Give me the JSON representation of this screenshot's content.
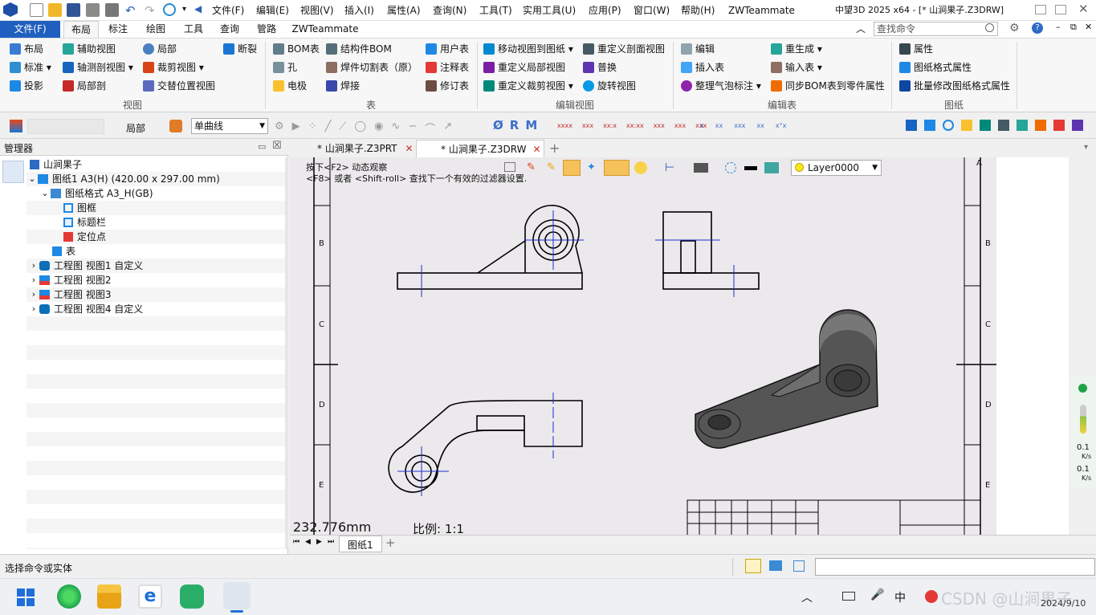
{
  "titlebar": {
    "window_title": "中望3D 2025 x64 - [* 山涧果子.Z3DRW]",
    "menus": [
      "文件(F)",
      "编辑(E)",
      "视图(V)",
      "插入(I)",
      "属性(A)",
      "查询(N)",
      "工具(T)",
      "实用工具(U)",
      "应用(P)",
      "窗口(W)",
      "帮助(H)",
      "ZWTeammate"
    ]
  },
  "ribbon_tabs": [
    "文件(F)",
    "布局",
    "标注",
    "绘图",
    "工具",
    "查询",
    "管路",
    "ZWTeammate"
  ],
  "active_tab": "布局",
  "search": {
    "placeholder": "查找命令"
  },
  "ribbon": {
    "view": {
      "label": "视图",
      "col1": [
        "布局",
        "标准 ▾",
        "投影"
      ],
      "col2": [
        "辅助视图",
        "轴测剖视图 ▾",
        "局部剖"
      ],
      "col3": [
        "局部",
        "裁剪视图 ▾",
        "交替位置视图"
      ],
      "col4": [
        "断裂"
      ]
    },
    "table": {
      "label": "表",
      "col1": [
        "BOM表",
        "孔",
        "电极"
      ],
      "col2": [
        "结构件BOM",
        "焊件切割表（原）",
        "焊接"
      ],
      "col3": [
        "用户表",
        "注释表",
        "修订表"
      ]
    },
    "edit_view": {
      "label": "编辑视图",
      "col1": [
        "移动视图到图纸 ▾",
        "重定义局部视图",
        "重定义裁剪视图 ▾"
      ],
      "col2": [
        "重定义剖面视图",
        "普换",
        "旋转视图"
      ]
    },
    "edit_table": {
      "label": "编辑表",
      "col1": [
        "编辑",
        "插入表",
        "整理气泡标注 ▾"
      ],
      "col2": [
        "重生成 ▾",
        "输入表 ▾",
        "同步BOM表到零件属性"
      ]
    },
    "drawing": {
      "label": "图纸",
      "col1": [
        "属性",
        "图纸格式属性",
        "批量修改图纸格式属性"
      ]
    }
  },
  "toolbar2": {
    "local_label": "局部",
    "curve_select": "单曲线"
  },
  "manager": {
    "title": "管理器",
    "tree": [
      {
        "label": "山涧果子",
        "level": 0
      },
      {
        "label": "图纸1 A3(H) (420.00 x 297.00 mm)",
        "level": 0,
        "expand": "⌄"
      },
      {
        "label": "图纸格式 A3_H(GB)",
        "level": 1,
        "expand": "⌄"
      },
      {
        "label": "图框",
        "level": 2
      },
      {
        "label": "标题栏",
        "level": 2
      },
      {
        "label": "定位点",
        "level": 2
      },
      {
        "label": "表",
        "level": 1
      },
      {
        "label": "工程图 视图1 自定义",
        "level": 0,
        "expand": "›"
      },
      {
        "label": "工程图 视图2",
        "level": 0,
        "expand": "›"
      },
      {
        "label": "工程图 视图3",
        "level": 0,
        "expand": "›"
      },
      {
        "label": "工程图 视图4 自定义",
        "level": 0,
        "expand": "›"
      }
    ]
  },
  "doc_tabs": [
    "* 山涧果子.Z3PRT",
    "* 山涧果子.Z3DRW"
  ],
  "active_doc": 1,
  "canvas": {
    "hint1": "按下<F2> 动态观察",
    "hint2": "<F8> 或者 <Shift-roll> 查找下一个有效的过滤器设置.",
    "layer": "Layer0000",
    "measure": "232.776mm",
    "scale": "比例:  1:1",
    "row_marks": [
      "A",
      "B",
      "C",
      "D",
      "E"
    ]
  },
  "sheet_tab": "图纸1",
  "status": {
    "prompt": "选择命令或实体"
  },
  "netmeter": {
    "up": "0.1",
    "up_unit": "K/s",
    "down": "0.1",
    "down_unit": "K/s"
  },
  "taskbar": {
    "clock": "2024/9/10",
    "watermark": "CSDN @山涧果子"
  }
}
